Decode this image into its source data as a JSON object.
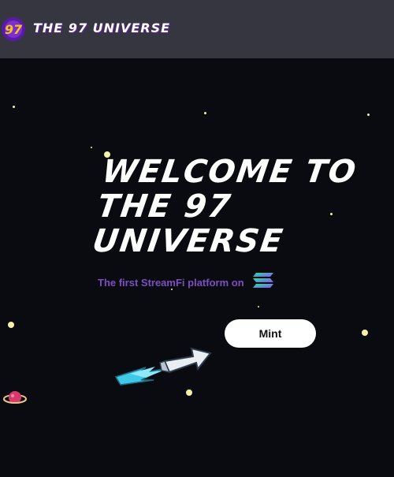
{
  "header": {
    "logo_text": "97",
    "brand_title": "THE 97 UNIVERSE"
  },
  "hero": {
    "title_line_1": "WELCOME TO",
    "title_line_2": "THE 97",
    "title_line_3": "UNIVERSE",
    "subtitle": "The first StreamFi platform on",
    "chain_icon": "solana-icon"
  },
  "actions": {
    "mint_label": "Mint"
  },
  "colors": {
    "accent_purple": "#7c4fc0",
    "background": "#0a0b10",
    "header": "#35363f"
  }
}
